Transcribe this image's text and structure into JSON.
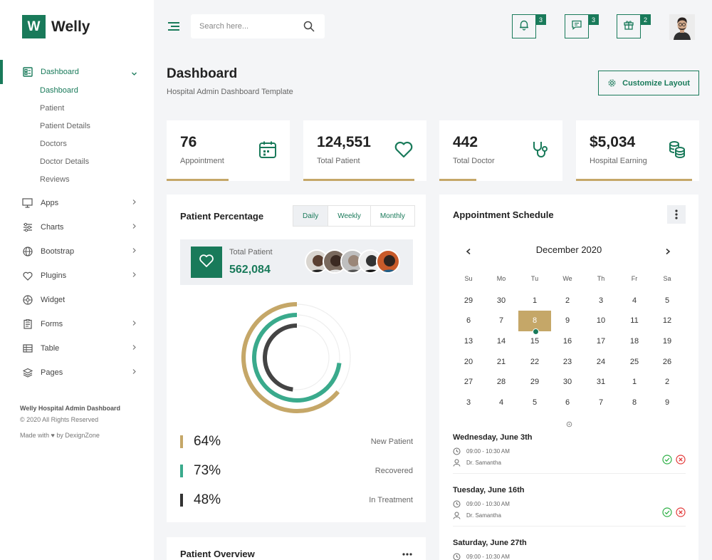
{
  "brand": {
    "logo_letter": "W",
    "name": "Welly"
  },
  "colors": {
    "primary": "#197a5a",
    "accent_gold": "#c5a768",
    "dark": "#444444",
    "bg": "#f4f5f7"
  },
  "sidebar": {
    "dashboard": {
      "label": "Dashboard",
      "icon": "dashboard-icon"
    },
    "submenu": [
      "Dashboard",
      "Patient",
      "Patient Details",
      "Doctors",
      "Doctor Details",
      "Reviews"
    ],
    "items": [
      {
        "label": "Apps",
        "icon": "monitor-icon"
      },
      {
        "label": "Charts",
        "icon": "sliders-icon"
      },
      {
        "label": "Bootstrap",
        "icon": "globe-icon"
      },
      {
        "label": "Plugins",
        "icon": "heart-icon"
      },
      {
        "label": "Widget",
        "icon": "widget-icon"
      },
      {
        "label": "Forms",
        "icon": "forms-icon"
      },
      {
        "label": "Table",
        "icon": "table-icon"
      },
      {
        "label": "Pages",
        "icon": "layers-icon"
      }
    ],
    "footer": {
      "title": "Welly Hospital Admin Dashboard",
      "copyright": "© 2020 All Rights Reserved",
      "credit": "Made with ♥ by DexignZone"
    }
  },
  "topbar": {
    "search_placeholder": "Search here...",
    "notifications": {
      "count": "3",
      "icon": "bell-icon"
    },
    "messages": {
      "count": "3",
      "icon": "chat-icon"
    },
    "gifts": {
      "count": "2",
      "icon": "gift-icon"
    }
  },
  "page": {
    "title": "Dashboard",
    "subtitle": "Hospital Admin Dashboard Template",
    "customize_label": "Customize Layout"
  },
  "stats": [
    {
      "value": "76",
      "label": "Appointment",
      "icon": "calendar-icon",
      "progress": 0.5
    },
    {
      "value": "124,551",
      "label": "Total Patient",
      "icon": "heart-icon",
      "progress": 0.9
    },
    {
      "value": "442",
      "label": "Total Doctor",
      "icon": "stethoscope-icon",
      "progress": 0.3
    },
    {
      "value": "$5,034",
      "label": "Hospital Earning",
      "icon": "coins-icon",
      "progress": 0.94
    }
  ],
  "patient_percentage": {
    "title": "Patient Percentage",
    "tabs": [
      "Daily",
      "Weekly",
      "Monthly"
    ],
    "active_tab": "Daily",
    "total_label": "Total Patient",
    "total_value": "562,084",
    "legend": [
      {
        "pct": "64%",
        "name": "New Patient",
        "color": "#c5a768",
        "value": 64
      },
      {
        "pct": "73%",
        "name": "Recovered",
        "color": "#3aaa8c",
        "value": 73
      },
      {
        "pct": "48%",
        "name": "In Treatment",
        "color": "#444444",
        "value": 48
      }
    ]
  },
  "patient_overview": {
    "title": "Patient Overview"
  },
  "schedule": {
    "title": "Appointment Schedule",
    "month": "December 2020",
    "weekdays": [
      "Su",
      "Mo",
      "Tu",
      "We",
      "Th",
      "Fr",
      "Sa"
    ],
    "weeks": [
      [
        "29",
        "30",
        "1",
        "2",
        "3",
        "4",
        "5"
      ],
      [
        "6",
        "7",
        "8",
        "9",
        "10",
        "11",
        "12"
      ],
      [
        "13",
        "14",
        "15",
        "16",
        "17",
        "18",
        "19"
      ],
      [
        "20",
        "21",
        "22",
        "23",
        "24",
        "25",
        "26"
      ],
      [
        "27",
        "28",
        "29",
        "30",
        "31",
        "1",
        "2"
      ],
      [
        "3",
        "4",
        "5",
        "6",
        "7",
        "8",
        "9"
      ]
    ],
    "selected": "8",
    "appointments": [
      {
        "date": "Wednesday, June 3th",
        "time": "09:00 - 10:30 AM",
        "doctor": "Dr. Samantha"
      },
      {
        "date": "Tuesday, June 16th",
        "time": "09:00 - 10:30 AM",
        "doctor": "Dr. Samantha"
      },
      {
        "date": "Saturday, June 27th",
        "time": "09:00 - 10:30 AM",
        "doctor": ""
      }
    ]
  }
}
